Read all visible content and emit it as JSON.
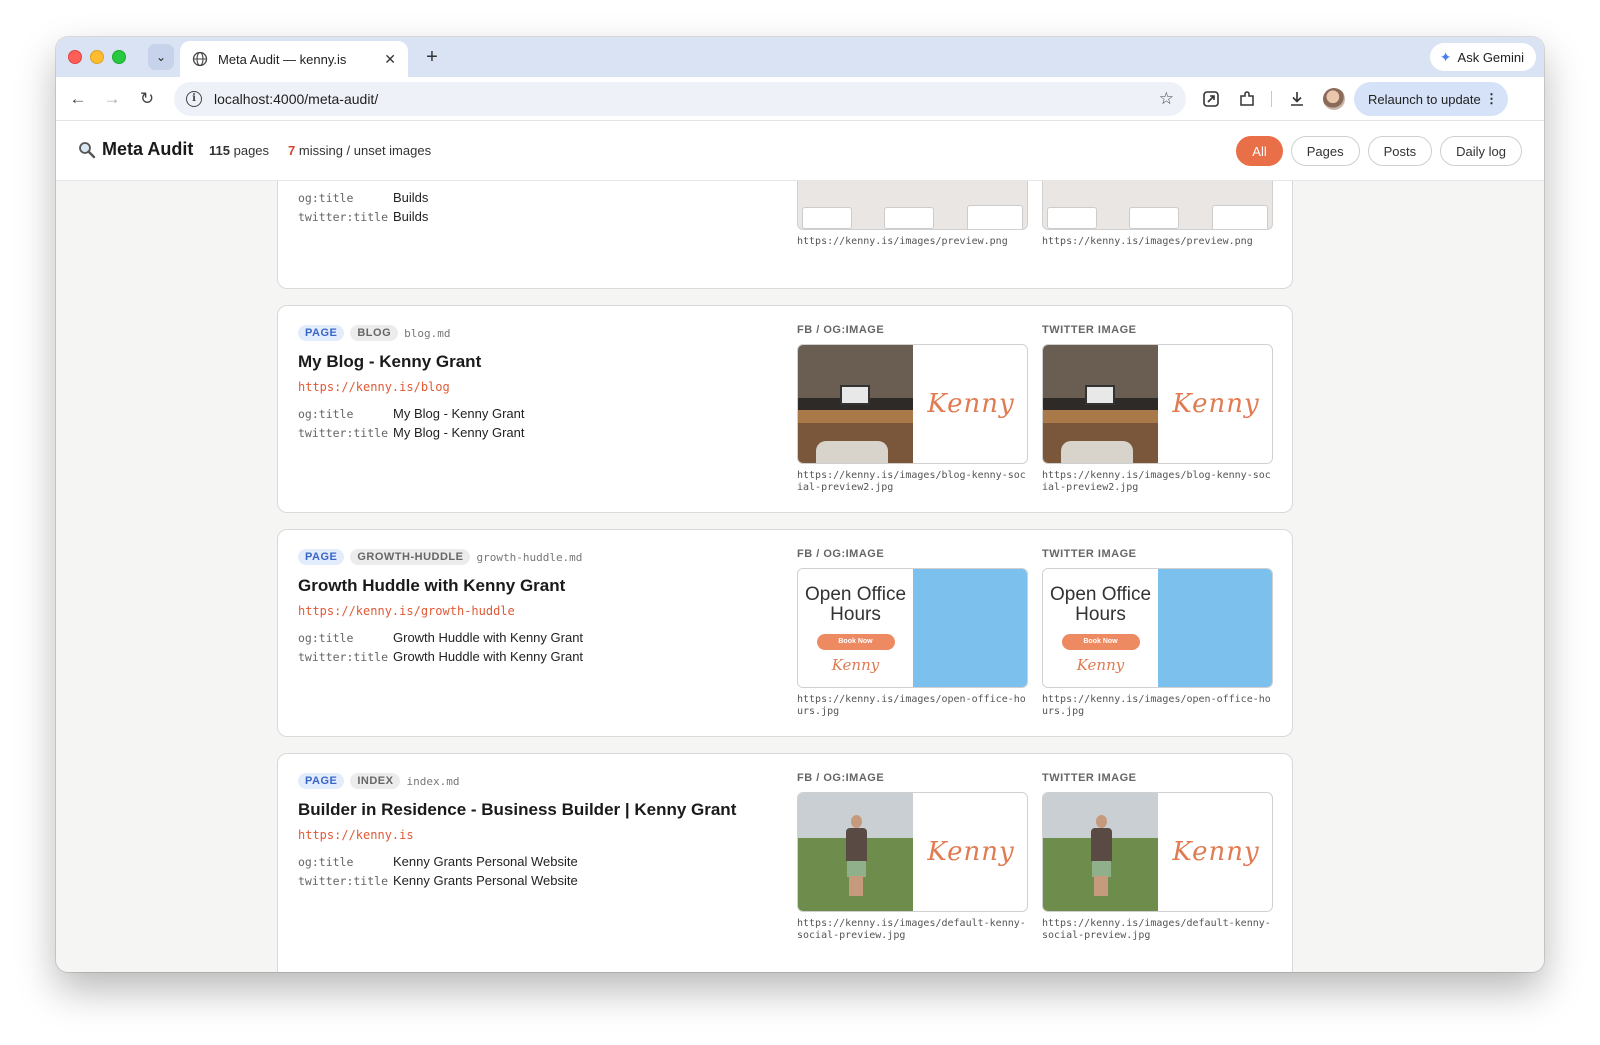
{
  "browser": {
    "tab_title": "Meta Audit — kenny.is",
    "url": "localhost:4000/meta-audit/",
    "gemini_label": "Ask Gemini",
    "relaunch_label": "Relaunch to update"
  },
  "app": {
    "title": "Meta Audit",
    "page_count": "115",
    "page_count_label": "pages",
    "missing_count": "7",
    "missing_label": "missing / unset images",
    "filters": [
      "All",
      "Pages",
      "Posts",
      "Daily log"
    ],
    "active_filter": "All"
  },
  "labels": {
    "og_key": "og:title",
    "twitter_key": "twitter:title",
    "fb_image": "FB / OG:IMAGE",
    "twitter_image": "TWITTER IMAGE"
  },
  "cards": [
    {
      "og_title": "Builds",
      "twitter_title": "Builds",
      "og_image_url": "https://kenny.is/images/preview.png",
      "twitter_image_url": "https://kenny.is/images/preview.png"
    },
    {
      "type": "PAGE",
      "section": "BLOG",
      "file": "blog.md",
      "title": "My Blog - Kenny Grant",
      "url": "https://kenny.is/blog",
      "og_title": "My Blog - Kenny Grant",
      "twitter_title": "My Blog - Kenny Grant",
      "og_image_url": "https://kenny.is/images/blog-kenny-social-preview2.jpg",
      "twitter_image_url": "https://kenny.is/images/blog-kenny-social-preview2.jpg",
      "image_text": "Kenny"
    },
    {
      "type": "PAGE",
      "section": "GROWTH-HUDDLE",
      "file": "growth-huddle.md",
      "title": "Growth Huddle with Kenny Grant",
      "url": "https://kenny.is/growth-huddle",
      "og_title": "Growth Huddle with Kenny Grant",
      "twitter_title": "Growth Huddle with Kenny Grant",
      "og_image_url": "https://kenny.is/images/open-office-hours.jpg",
      "twitter_image_url": "https://kenny.is/images/open-office-hours.jpg",
      "image_heading": "Open Office Hours",
      "image_button": "Book Now",
      "image_text": "Kenny"
    },
    {
      "type": "PAGE",
      "section": "INDEX",
      "file": "index.md",
      "title": "Builder in Residence - Business Builder | Kenny Grant",
      "url": "https://kenny.is",
      "og_title": "Kenny Grants Personal Website",
      "twitter_title": "Kenny Grants Personal Website",
      "og_image_url": "https://kenny.is/images/default-kenny-social-preview.jpg",
      "twitter_image_url": "https://kenny.is/images/default-kenny-social-preview.jpg",
      "image_text": "Kenny"
    }
  ],
  "colors": {
    "accent": "#e86f48",
    "url_color": "#e05a35",
    "type_badge": "#3867c9"
  }
}
